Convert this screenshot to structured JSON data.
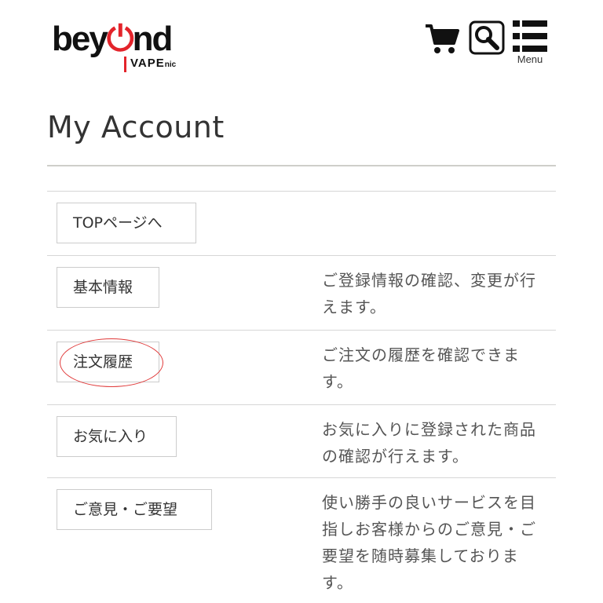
{
  "header": {
    "logo_word": "beyond",
    "logo_power": "ö",
    "logo_sub": "VAPE",
    "logo_sub_small": "nic",
    "menu_label": "Menu",
    "icons": [
      "cart-icon",
      "search-icon",
      "menu-icon"
    ]
  },
  "title": "My Account",
  "rows": [
    {
      "button": "TOPページへ",
      "desc": ""
    },
    {
      "button": "基本情報",
      "desc": "ご登録情報の確認、変更が行えます。"
    },
    {
      "button": "注文履歴",
      "desc": "ご注文の履歴を確認できます。"
    },
    {
      "button": "お気に入り",
      "desc": "お気に入りに登録された商品の確認が行えます。"
    },
    {
      "button": "ご意見・ご要望",
      "desc": "使い勝手の良いサービスを目指しお客様からのご意見・ご要望を随時募集しております。"
    }
  ],
  "colors": {
    "accent": "#e3242b",
    "text": "#333333",
    "border": "#cccccc",
    "highlight": "#e03a3a"
  }
}
